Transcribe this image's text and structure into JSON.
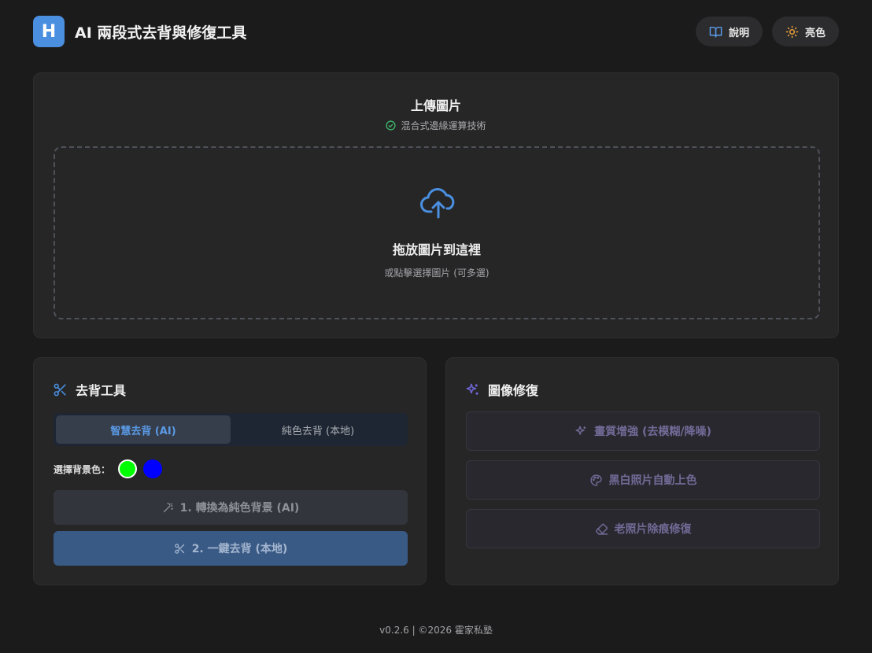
{
  "header": {
    "logo_letter": "H",
    "title": "AI 兩段式去背與修復工具",
    "help_label": "說明",
    "theme_label": "亮色"
  },
  "upload": {
    "title": "上傳圖片",
    "subtitle": "混合式邊緣運算技術",
    "drop_title": "拖放圖片到這裡",
    "drop_subtitle": "或點擊選擇圖片 (可多選)"
  },
  "bg_tool": {
    "title": "去背工具",
    "tabs": [
      {
        "label": "智慧去背 (AI)",
        "active": true
      },
      {
        "label": "純色去背 (本地)",
        "active": false
      }
    ],
    "color_label": "選擇背景色：",
    "colors": [
      "#00ff00",
      "#0000ff"
    ],
    "convert_button": "1. 轉換為純色背景 (AI)",
    "remove_button": "2. 一鍵去背 (本地)"
  },
  "restore": {
    "title": "圖像修復",
    "enhance_button": "畫質增強 (去模糊/降噪)",
    "colorize_button": "黑白照片自動上色",
    "scratch_button": "老照片除痕修復"
  },
  "colors": {
    "accent": "#4a8fe0",
    "violet": "#6f66d6",
    "background": "#1b1b1c",
    "card": "#262627"
  },
  "footer": {
    "text": "v0.2.6 | ©2026 霍家私塾"
  }
}
